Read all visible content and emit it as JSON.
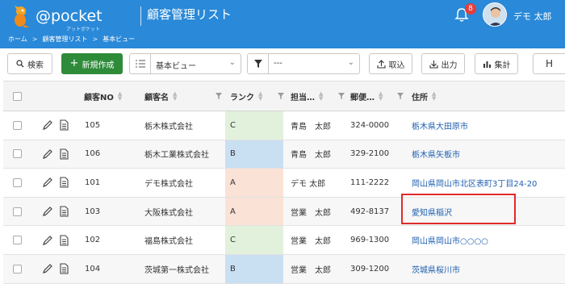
{
  "header": {
    "logo_text": "@pocket",
    "logo_sub": "アットポケット",
    "app_title": "顧客管理リスト",
    "notification_count": "8",
    "user_name": "デモ 太郎",
    "background": "#2a89d8"
  },
  "breadcrumb": [
    "ホーム",
    "顧客管理リスト",
    "基本ビュー"
  ],
  "toolbar": {
    "search_label": "検索",
    "new_label": "新規作成",
    "view_value": "基本ビュー",
    "filter_value": "---",
    "import_label": "取込",
    "export_label": "出力",
    "aggregate_label": "集計",
    "extra_label": "H"
  },
  "table": {
    "columns": [
      "顧客NO",
      "顧客名",
      "ランク",
      "担当…",
      "郵便…",
      "住所"
    ],
    "rows": [
      {
        "no": "105",
        "name": "栃木株式会社",
        "rank": "C",
        "staff": "青島　太郎",
        "zip": "324-0000",
        "address": "栃木県大田原市"
      },
      {
        "no": "106",
        "name": "栃木工業株式会社",
        "rank": "B",
        "staff": "青島　太郎",
        "zip": "329-2100",
        "address": "栃木県矢板市"
      },
      {
        "no": "101",
        "name": "デモ株式会社",
        "rank": "A",
        "staff": "デモ 太郎",
        "zip": "111-2222",
        "address": "岡山県岡山市北区表町3丁目24-20"
      },
      {
        "no": "103",
        "name": "大阪株式会社",
        "rank": "A",
        "staff": "営業　太郎",
        "zip": "492-8137",
        "address": "愛知県稲沢"
      },
      {
        "no": "102",
        "name": "福島株式会社",
        "rank": "C",
        "staff": "営業　太郎",
        "zip": "969-1300",
        "address": "岡山県岡山市○○○○"
      },
      {
        "no": "104",
        "name": "茨城第一株式会社",
        "rank": "B",
        "staff": "営業　太郎",
        "zip": "309-1200",
        "address": "茨城県桜川市"
      }
    ]
  },
  "colors": {
    "primary_button": "#2e8b3a",
    "rank_A": "#fbe2d6",
    "rank_B": "#c9dff2",
    "rank_C": "#e2f1dc",
    "link": "#1f5fb0",
    "highlight": "#e02a2a"
  }
}
